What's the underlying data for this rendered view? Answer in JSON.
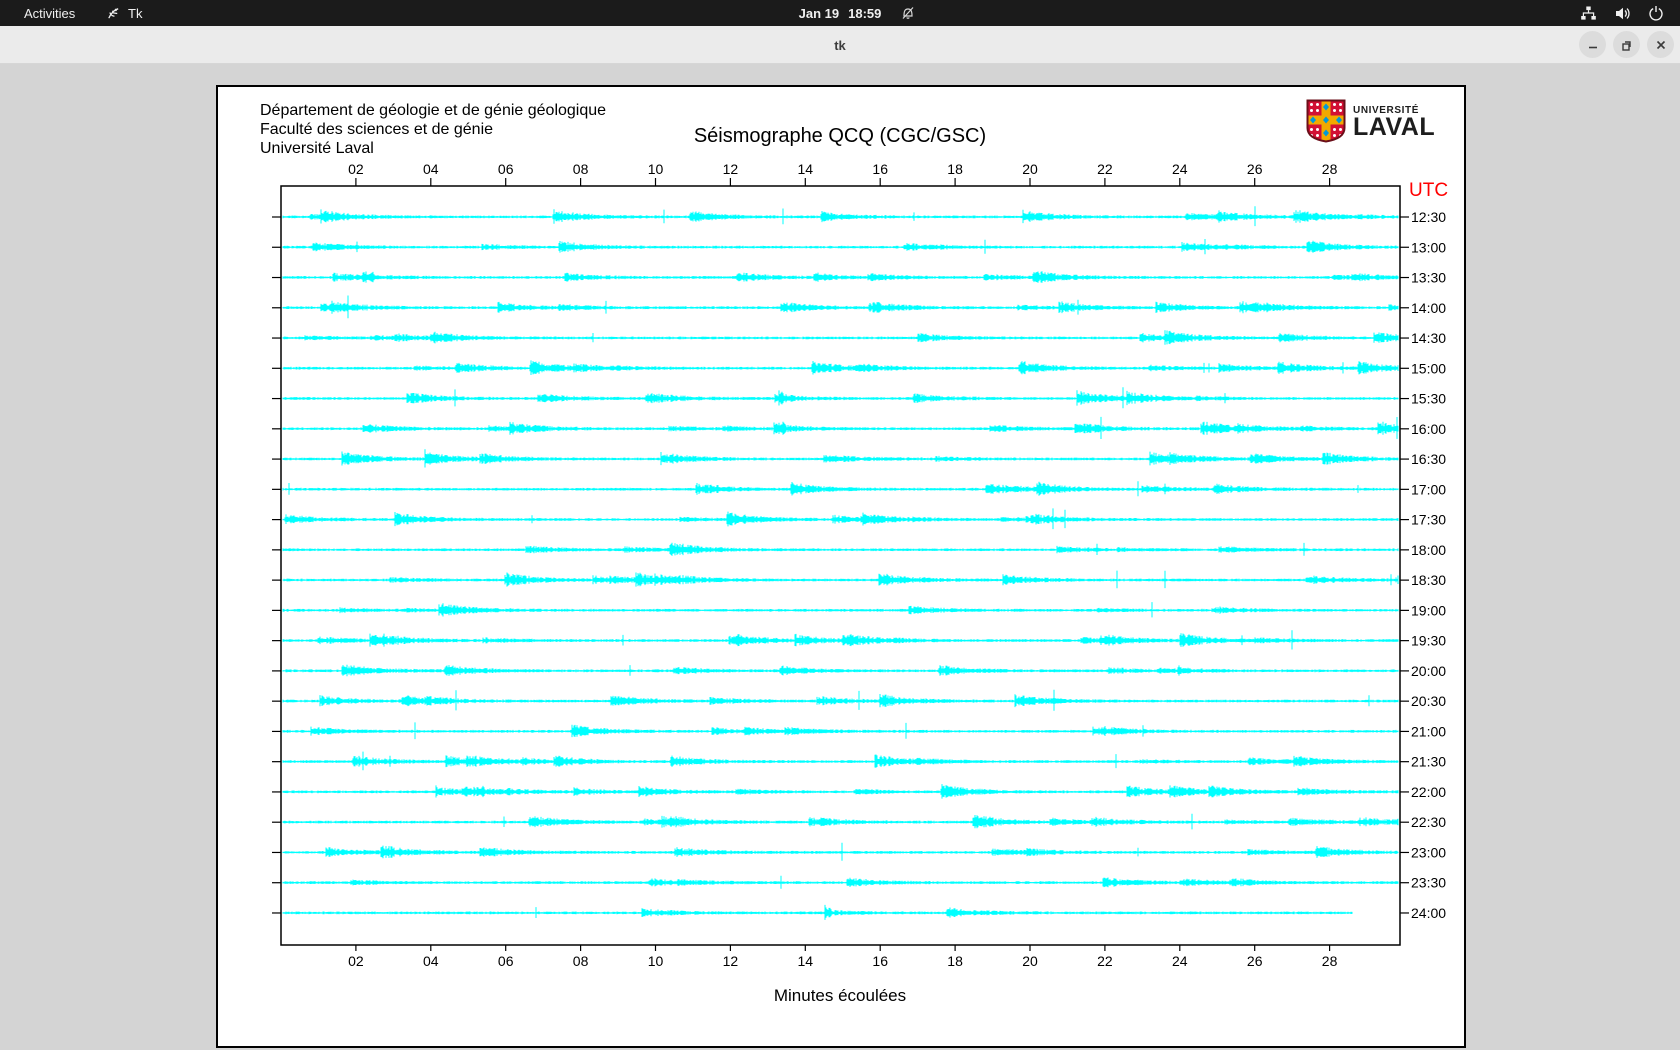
{
  "topbar": {
    "activities": "Activities",
    "app_name": "Tk",
    "clock_date": "Jan 19",
    "clock_time": "18:59",
    "icons": [
      "tk-icon",
      "notifications-muted-icon",
      "network-wired-icon",
      "volume-icon",
      "power-icon"
    ]
  },
  "titlebar": {
    "title": "tk",
    "buttons": [
      "minimize",
      "maximize",
      "close"
    ]
  },
  "document": {
    "institution_lines": [
      "Département de géologie et de génie géologique",
      "Faculté des sciences et de génie",
      "Université Laval"
    ],
    "title": "Séismographe QCQ (CGC/GSC)",
    "logo": {
      "line1": "UNIVERSITÉ",
      "line2": "LAVAL"
    },
    "utc_label": "UTC",
    "xlabel": "Minutes écoulées"
  },
  "chart_data": {
    "type": "line",
    "subtype": "helicorder-seismogram",
    "station": "QCQ (CGC/GSC)",
    "title": "Séismographe QCQ (CGC/GSC)",
    "xlabel": "Minutes écoulées",
    "x_ticks": [
      "02",
      "04",
      "06",
      "08",
      "10",
      "12",
      "14",
      "16",
      "18",
      "20",
      "22",
      "24",
      "26",
      "28"
    ],
    "x_range_minutes": [
      0,
      30
    ],
    "utc_label": "UTC",
    "trace_color": "#00ffff",
    "axis_color": "#000000",
    "utc_color": "#ff0000",
    "rows": [
      {
        "time": "12:30"
      },
      {
        "time": "13:00"
      },
      {
        "time": "13:30"
      },
      {
        "time": "14:00"
      },
      {
        "time": "14:30"
      },
      {
        "time": "15:00"
      },
      {
        "time": "15:30"
      },
      {
        "time": "16:00"
      },
      {
        "time": "16:30"
      },
      {
        "time": "17:00"
      },
      {
        "time": "17:30"
      },
      {
        "time": "18:00"
      },
      {
        "time": "18:30"
      },
      {
        "time": "19:00"
      },
      {
        "time": "19:30"
      },
      {
        "time": "20:00"
      },
      {
        "time": "20:30"
      },
      {
        "time": "21:00"
      },
      {
        "time": "21:30"
      },
      {
        "time": "22:00"
      },
      {
        "time": "22:30"
      },
      {
        "time": "23:00"
      },
      {
        "time": "23:30"
      },
      {
        "time": "24:00",
        "end_minute": 28.6
      }
    ],
    "row_description": "24 half-hour helicorder traces of continuous seismic background noise; low-amplitude microseism fluctuations with occasional short bursts; the final 24:00 trace stops near minute 28.6."
  }
}
